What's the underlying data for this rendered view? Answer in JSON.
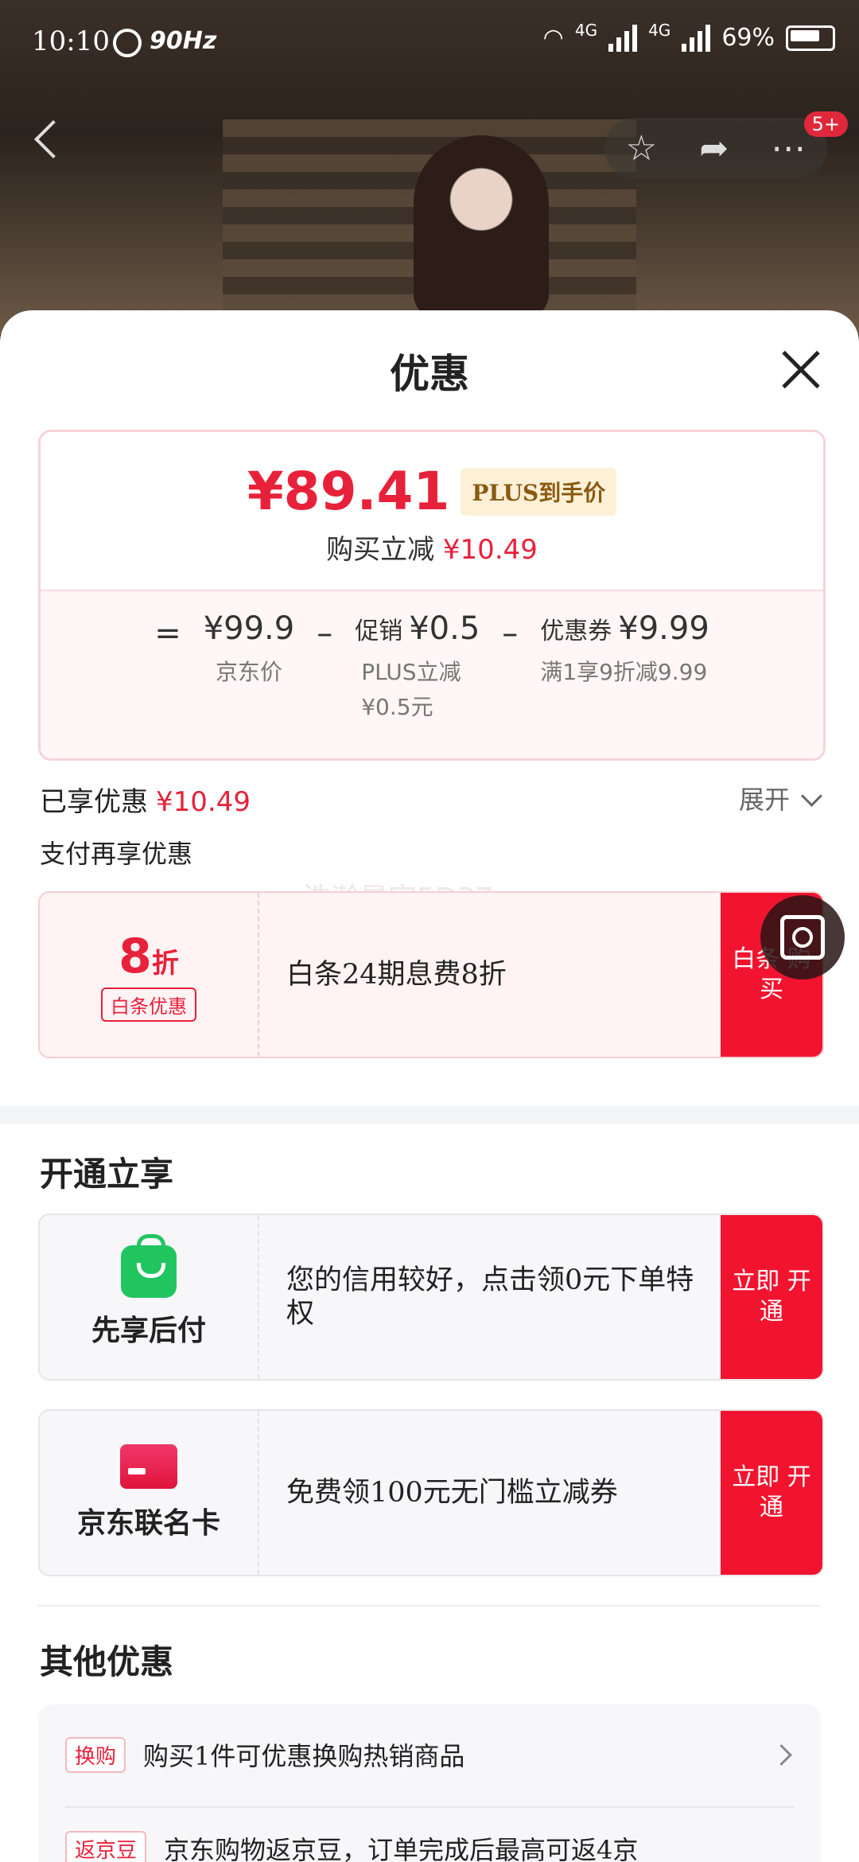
{
  "status": {
    "time": "10:10",
    "refresh": "90Hz",
    "net1": "4G",
    "net2": "4G",
    "battery": "69%"
  },
  "nav": {
    "badge": "5+"
  },
  "sheet": {
    "title": "优惠",
    "price": {
      "final": "¥89.41",
      "tag": "PLUS到手价",
      "sub_label": "购买立减",
      "sub_value": "¥10.49",
      "eq": "=",
      "minus": "–",
      "base_amount": "¥99.9",
      "base_label": "京东价",
      "promo_prefix": "促销",
      "promo_amount": "¥0.5",
      "promo_label": "PLUS立减 ¥0.5元",
      "coupon_prefix": "优惠券",
      "coupon_amount": "¥9.99",
      "coupon_label": "满1享9折减9.99"
    },
    "enjoyed_label": "已享优惠",
    "enjoyed_value": "¥10.49",
    "expand_label": "展开",
    "pay_title": "支付再享优惠",
    "watermark": "浩瀚星空5D37",
    "baitiao": {
      "discount": "8",
      "discount_unit": "折",
      "tag": "白条优惠",
      "desc": "白条24期息费8折",
      "button": "白条 购买"
    },
    "open_title": "开通立享",
    "xianxiang": {
      "name": "先享后付",
      "desc": "您的信用较好，点击领0元下单特权",
      "button": "立即 开通"
    },
    "jdcard": {
      "name": "京东联名卡",
      "desc": "免费领100元无门槛立减券",
      "button": "立即 开通"
    },
    "other_title": "其他优惠",
    "others": [
      {
        "tag": "换购",
        "text": "购买1件可优惠换购热销商品"
      },
      {
        "tag": "返京豆",
        "text": "京东购物返京豆，订单完成后最高可返4京"
      }
    ]
  }
}
